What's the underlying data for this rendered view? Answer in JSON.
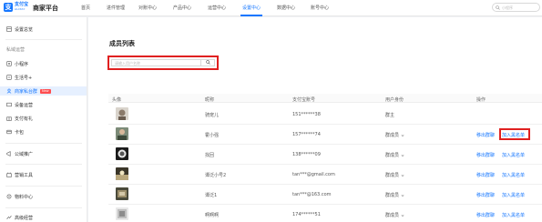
{
  "topbar": {
    "logo_cn": "支付宝",
    "logo_en": "ALIPAY",
    "platform": "商家平台",
    "search_placeholder": "小程序",
    "nav": [
      {
        "label": "首页"
      },
      {
        "label": "进件管理"
      },
      {
        "label": "对账中心"
      },
      {
        "label": "产品中心"
      },
      {
        "label": "运营中心"
      },
      {
        "label": "设置中心",
        "active": true
      },
      {
        "label": "数据中心"
      },
      {
        "label": "账号中心"
      }
    ]
  },
  "sidebar": {
    "top_item": "设置总览",
    "group_label": "私域运营",
    "items": [
      {
        "label": "小程序"
      },
      {
        "label": "生活号+"
      },
      {
        "label": "商家私台群",
        "badge": "New",
        "active": true
      },
      {
        "label": "设备运营"
      },
      {
        "label": "支付有礼"
      },
      {
        "label": "卡包"
      }
    ],
    "section_items": [
      {
        "label": "公域推广"
      },
      {
        "label": "营销工具"
      },
      {
        "label": "物料中心"
      },
      {
        "label": "高级经营"
      }
    ]
  },
  "main": {
    "title": "成员列表",
    "search_placeholder": "请输入用户名称",
    "columns": [
      "头像",
      "昵称",
      "支付宝账号",
      "用户身份",
      "操作"
    ],
    "rows": [
      {
        "nickname": "骑宠儿",
        "account": "151******38",
        "role": "群主",
        "has_dropdown": false,
        "ops": []
      },
      {
        "nickname": "霍小强",
        "account": "157******74",
        "role": "群成员",
        "has_dropdown": true,
        "ops": [
          "移出群聊",
          "加入黑名单"
        ]
      },
      {
        "nickname": "找回",
        "account": "138******09",
        "role": "群成员",
        "has_dropdown": true,
        "ops": [
          "移出群聊",
          "加入黑名单"
        ]
      },
      {
        "nickname": "谭泛小号2",
        "account": "tan***@gmail.com",
        "role": "群成员",
        "has_dropdown": true,
        "ops": [
          "移出群聊",
          "加入黑名单"
        ]
      },
      {
        "nickname": "谭泛1",
        "account": "tan***@163.com",
        "role": "群成员",
        "has_dropdown": true,
        "ops": [
          "移出群聊",
          "加入黑名单"
        ]
      },
      {
        "nickname": "啊啊啊",
        "account": "174******51",
        "role": "群成员",
        "has_dropdown": true,
        "ops": [
          "移出群聊",
          "加入黑名单"
        ]
      }
    ]
  },
  "colors": {
    "accent": "#1677ff",
    "highlight": "#e02020"
  }
}
